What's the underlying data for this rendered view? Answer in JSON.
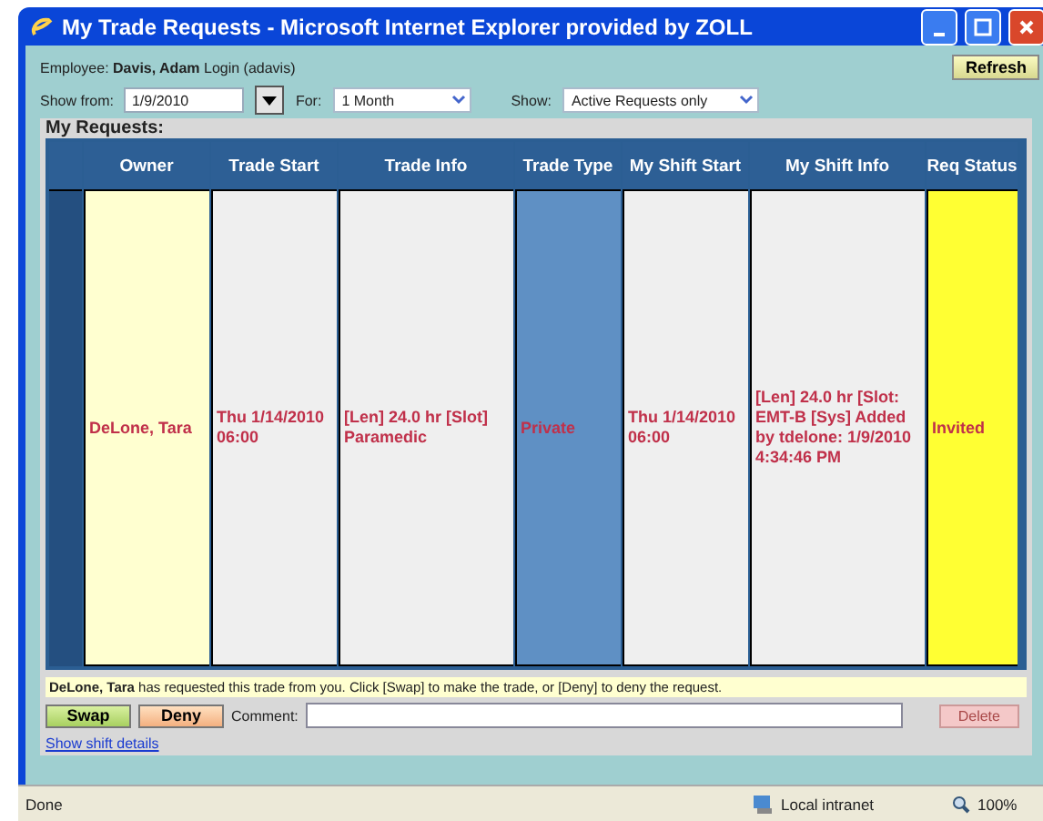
{
  "window": {
    "title": "My Trade Requests - Microsoft Internet Explorer provided by ZOLL"
  },
  "employee": {
    "label": "Employee:",
    "name": "Davis, Adam",
    "login": "Login (adavis)"
  },
  "refresh_button": "Refresh",
  "filters": {
    "show_from_label": "Show from:",
    "show_from_value": "1/9/2010",
    "for_label": "For:",
    "for_value": "1 Month",
    "show_label": "Show:",
    "show_value": "Active Requests only"
  },
  "section_title": "My Requests:",
  "table": {
    "columns": [
      "Owner",
      "Trade Start",
      "Trade Info",
      "Trade Type",
      "My Shift Start",
      "My Shift Info",
      "Req Status"
    ],
    "rows": [
      {
        "selected": true,
        "cells": [
          {
            "text": "DeLone, Tara",
            "color": "#ffffd0"
          },
          {
            "text": "Thu 1/14/2010 06:00",
            "color": "#efefef"
          },
          {
            "text": "[Len] 24.0 hr [Slot] Paramedic",
            "color": "#efefef"
          },
          {
            "text": "Private",
            "color": "#5f90c4"
          },
          {
            "text": "Thu 1/14/2010 06:00",
            "color": "#efefef"
          },
          {
            "text": "[Len] 24.0 hr [Slot: EMT-B [Sys] Added by tdelone: 1/9/2010 4:34:46 PM",
            "color": "#efefef"
          },
          {
            "text": "Invited",
            "color": "#ffff33"
          }
        ]
      }
    ]
  },
  "message": "**DeLone, Tara** has requested this trade from you. Click [Swap] to make the trade, or [Deny] to deny the request.",
  "actions": {
    "swap": "Swap",
    "deny": "Deny",
    "comment_label": "Comment:",
    "delete": "Delete",
    "delete_disabled": true
  },
  "details_link": "Show shift details",
  "status_bar": {
    "text": "Done",
    "zone": "Local intranet",
    "zoom": "100%"
  }
}
